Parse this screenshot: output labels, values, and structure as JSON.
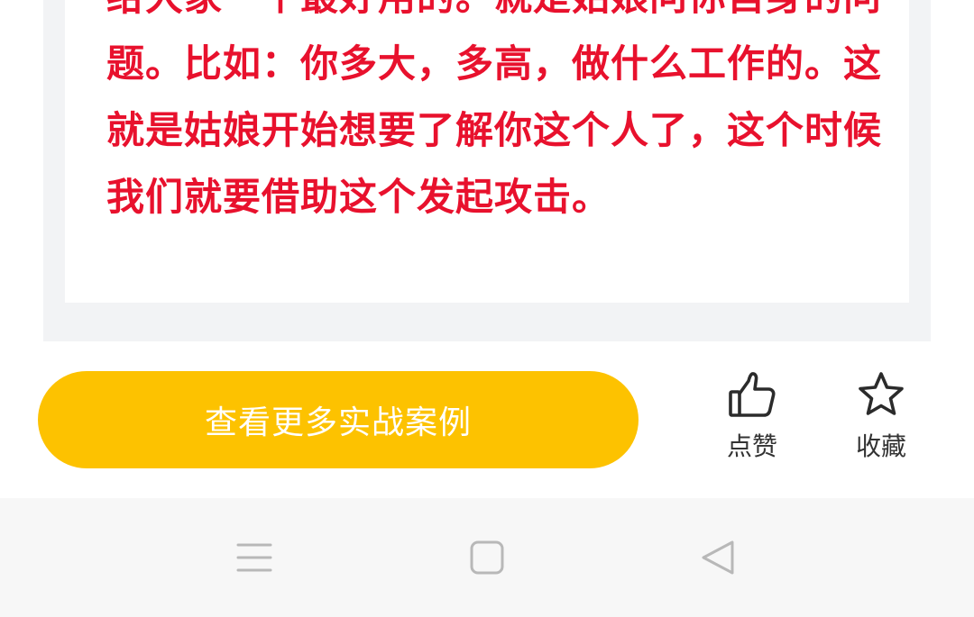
{
  "article": {
    "text": "给大家一个最好用的。就是姑娘问你自身的问题。比如：你多大，多高，做什么工作的。这就是姑娘开始想要了解你这个人了，这个时候我们就要借助这个发起攻击。",
    "text_color": "#e8112d"
  },
  "actions": {
    "cta_label": "查看更多实战案例",
    "cta_color": "#fdc200",
    "like_label": "点赞",
    "like_icon": "thumbs-up-icon",
    "favorite_label": "收藏",
    "favorite_icon": "star-icon"
  },
  "navigation": {
    "menu_icon": "menu-icon",
    "home_icon": "home-square-icon",
    "back_icon": "back-triangle-icon"
  }
}
